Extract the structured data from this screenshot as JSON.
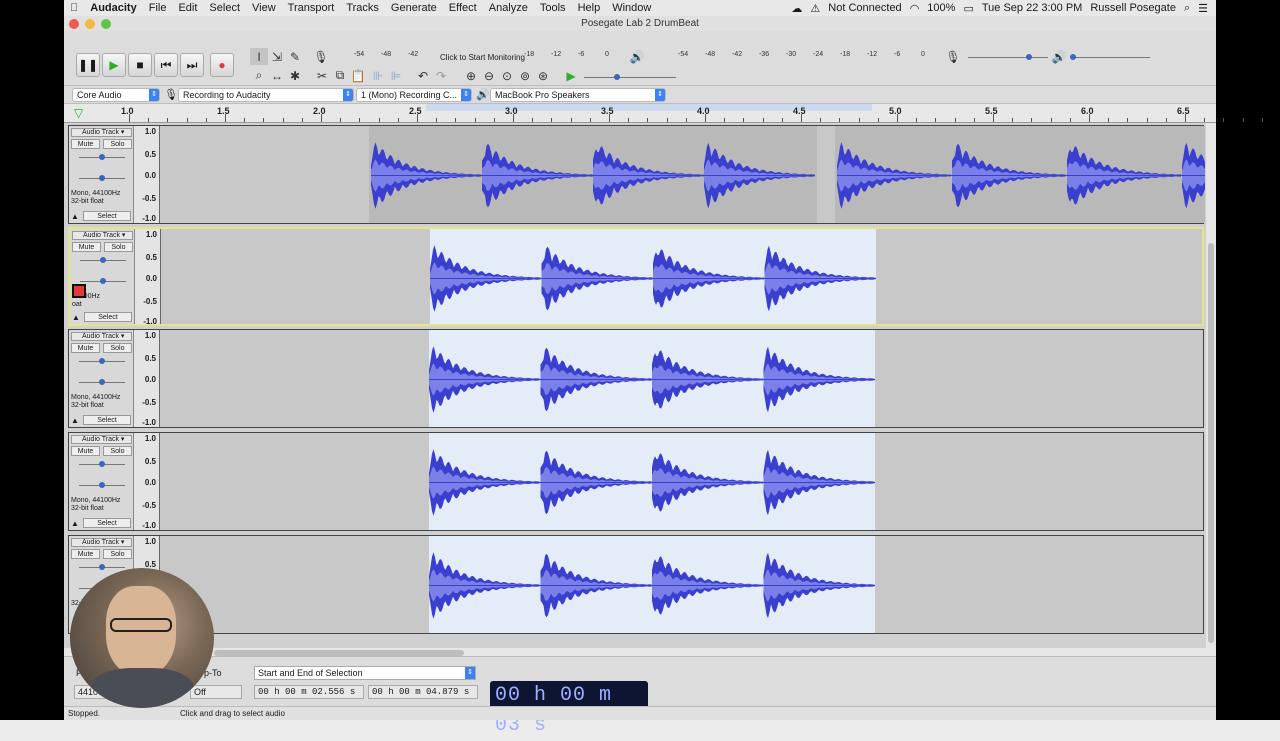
{
  "menubar": {
    "app": "Audacity",
    "items": [
      "File",
      "Edit",
      "Select",
      "View",
      "Transport",
      "Tracks",
      "Generate",
      "Effect",
      "Analyze",
      "Tools",
      "Help",
      "Window"
    ],
    "status_not_connected": "Not Connected",
    "battery": "100%",
    "datetime": "Tue Sep 22  3:00 PM",
    "user": "Russell Posegate"
  },
  "window": {
    "title": "Posegate Lab 2 DrumBeat"
  },
  "toolbar": {
    "monitor_hint": "Click to Start Monitoring",
    "rec_meter_scale": [
      "-54",
      "-48",
      "-42",
      "",
      "-18",
      "-12",
      "-6",
      "0"
    ],
    "play_meter_scale": [
      "-54",
      "-48",
      "-42",
      "-36",
      "-30",
      "-24",
      "-18",
      "-12",
      "-6",
      "0"
    ]
  },
  "devices": {
    "host": "Core Audio",
    "recording": "Recording to Audacity",
    "channels": "1 (Mono) Recording C...",
    "playback": "MacBook Pro Speakers"
  },
  "ruler": {
    "labels": [
      "1.0",
      "1.5",
      "2.0",
      "2.5",
      "3.0",
      "3.5",
      "4.0",
      "4.5",
      "5.0",
      "5.5",
      "6.0",
      "6.5"
    ]
  },
  "tracks": [
    {
      "name": "Audio Track",
      "mute": "Mute",
      "solo": "Solo",
      "info1": "Mono, 44100Hz",
      "info2": "32-bit float",
      "select": "Select"
    },
    {
      "name": "Audio Track",
      "mute": "Mute",
      "solo": "Solo",
      "info1": "44100Hz",
      "info2": "oat",
      "select": "Select"
    },
    {
      "name": "Audio Track",
      "mute": "Mute",
      "solo": "Solo",
      "info1": "Mono, 44100Hz",
      "info2": "32-bit float",
      "select": "Select"
    },
    {
      "name": "Audio Track",
      "mute": "Mute",
      "solo": "Solo",
      "info1": "Mono, 44100Hz",
      "info2": "32-bit float",
      "select": "Select"
    },
    {
      "name": "Audio Track",
      "mute": "Mute",
      "solo": "Solo",
      "info1": "",
      "info2": "32-bit",
      "select": ""
    }
  ],
  "vscale": [
    "1.0",
    "0.5",
    "0.0",
    "-0.5",
    "-1.0"
  ],
  "selection": {
    "project_rate_label": "Pro",
    "project_rate": "44100",
    "snap_label": "p-To",
    "snap_value": "Off",
    "mode": "Start and End of Selection",
    "start": "00 h 00 m 02.556 s",
    "end": "00 h 00 m 04.879 s",
    "audio_position": "00 h 00 m 03 s"
  },
  "status": {
    "state": "Stopped.",
    "hint": "Click and drag to select audio"
  },
  "colors": {
    "waveform": "#3a3fd0",
    "waveform_rms": "#7a80e8",
    "selection_bg": "#e4ecf8",
    "record": "#e03a3a",
    "play": "#2fae2f"
  }
}
